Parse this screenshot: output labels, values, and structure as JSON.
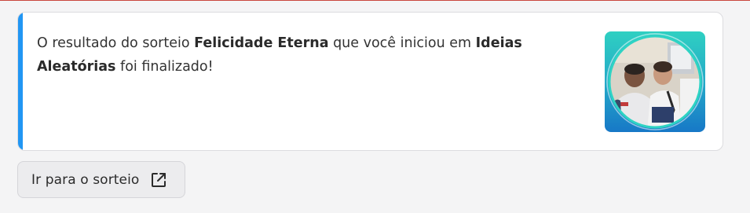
{
  "notification": {
    "text_prefix": "O resultado do sorteio ",
    "giveaway_name": "Felicidade Eterna",
    "text_middle": " que você iniciou em ",
    "group_name": "Ideias Aleatórias",
    "text_suffix": " foi finalizado!",
    "accent_color": "#2196f3",
    "thumbnail": {
      "description": "two-people-photo",
      "ring_color": "#2ed3c4"
    }
  },
  "action": {
    "label": "Ir para o sorteio",
    "icon": "external-link-icon"
  }
}
